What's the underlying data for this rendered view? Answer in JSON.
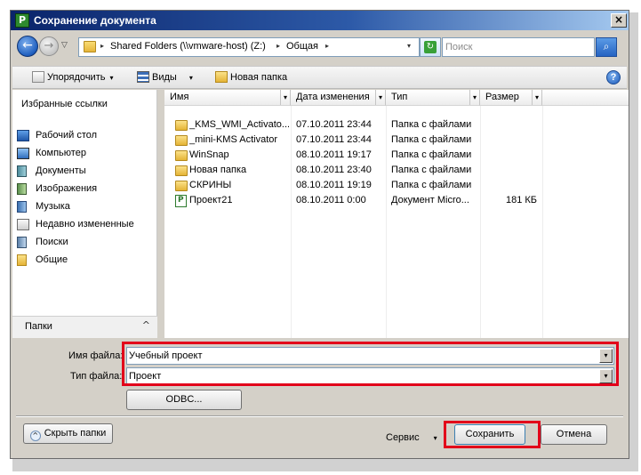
{
  "window": {
    "title": "Сохранение документа",
    "app_icon": "P",
    "close_glyph": "×"
  },
  "nav": {
    "back_glyph": "←",
    "forward_glyph": "→",
    "history_glyph": "▽",
    "address_segments": [
      "Shared Folders (\\\\vmware-host) (Z:)",
      "Общая"
    ],
    "segment_arrow": "▸",
    "dropdown_arrow": "▾",
    "refresh_glyph": "↻",
    "search_placeholder": "Поиск",
    "search_glyph": "⌕"
  },
  "toolbar": {
    "organize_label": "Упорядочить",
    "views_label": "Виды",
    "new_folder_label": "Новая папка",
    "dropdown_arrow": "▾",
    "help_glyph": "?"
  },
  "sidebar": {
    "favorites_title": "Избранные ссылки",
    "items": [
      {
        "label": "Рабочий стол",
        "icon": "desktop-icon"
      },
      {
        "label": "Компьютер",
        "icon": "computer-icon"
      },
      {
        "label": "Документы",
        "icon": "documents-icon"
      },
      {
        "label": "Изображения",
        "icon": "pictures-icon"
      },
      {
        "label": "Музыка",
        "icon": "music-icon"
      },
      {
        "label": "Недавно измененные",
        "icon": "recent-icon"
      },
      {
        "label": "Поиски",
        "icon": "searches-icon"
      },
      {
        "label": "Общие",
        "icon": "folder-icon"
      }
    ],
    "folders_label": "Папки",
    "folders_chevron": "^"
  },
  "files": {
    "columns": {
      "name": "Имя",
      "date": "Дата изменения",
      "type": "Тип",
      "size": "Размер",
      "dropdown_arrow": "▾"
    },
    "rows": [
      {
        "name": "_KMS_WMI_Activato...",
        "date": "07.10.2011 23:44",
        "type": "Папка с файлами",
        "size": "",
        "icon": "folder-icon"
      },
      {
        "name": "_mini-KMS Activator",
        "date": "07.10.2011 23:44",
        "type": "Папка с файлами",
        "size": "",
        "icon": "folder-icon"
      },
      {
        "name": "WinSnap",
        "date": "08.10.2011 19:17",
        "type": "Папка с файлами",
        "size": "",
        "icon": "folder-icon"
      },
      {
        "name": "Новая папка",
        "date": "08.10.2011 23:40",
        "type": "Папка с файлами",
        "size": "",
        "icon": "folder-icon"
      },
      {
        "name": "СКРИНЫ",
        "date": "08.10.2011 19:19",
        "type": "Папка с файлами",
        "size": "",
        "icon": "folder-icon"
      },
      {
        "name": "Проект21",
        "date": "08.10.2011 0:00",
        "type": "Документ Micro...",
        "size": "181 КБ",
        "icon": "project-file-icon"
      }
    ]
  },
  "form": {
    "filename_label": "Имя файла:",
    "filename_value": "Учебный проект",
    "filetype_label": "Тип файла:",
    "filetype_value": "Проект",
    "dropdown_arrow": "▾",
    "highlight_color": "#e2001a"
  },
  "buttons": {
    "odbc": "ODBC...",
    "hide_folders": "Скрыть папки",
    "hide_chevron": "^",
    "service": "Сервис",
    "service_arrow": "▾",
    "save": "Сохранить",
    "cancel": "Отмена"
  }
}
